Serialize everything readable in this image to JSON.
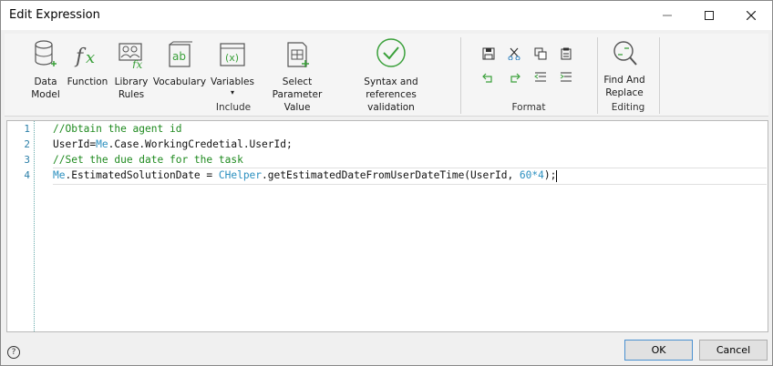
{
  "window": {
    "title": "Edit Expression"
  },
  "ribbon": {
    "include": {
      "label": "Include",
      "buttons": [
        {
          "label_line1": "Data",
          "label_line2": "Model",
          "icon": "database-icon"
        },
        {
          "label_line1": "Function",
          "label_line2": "",
          "icon": "function-icon"
        },
        {
          "label_line1": "Library",
          "label_line2": "Rules",
          "icon": "library-rules-icon"
        },
        {
          "label_line1": "Vocabulary",
          "label_line2": "",
          "icon": "vocabulary-icon"
        },
        {
          "label_line1": "Variables",
          "label_line2": "▾",
          "icon": "variables-icon"
        },
        {
          "label_line1": "Select Parameter",
          "label_line2": "Value",
          "icon": "parameter-icon"
        },
        {
          "label_line1": "Syntax and references",
          "label_line2": "validation",
          "icon": "check-icon"
        }
      ]
    },
    "format": {
      "label": "Format"
    },
    "editing": {
      "label": "Editing",
      "find_line1": "Find And",
      "find_line2": "Replace"
    }
  },
  "editor": {
    "line_numbers": [
      "1",
      "2",
      "3",
      "4"
    ],
    "lines": {
      "l1": "//Obtain the agent id",
      "l2a": "UserId=",
      "l2b": "Me",
      "l2c": ".Case.WorkingCredetial.UserId;",
      "l3": "//Set the due date for the task",
      "l4a": "Me",
      "l4b": ".EstimatedSolutionDate = ",
      "l4c": "CHelper",
      "l4d": ".getEstimatedDateFromUserDateTime(UserId, ",
      "l4e": "60*4",
      "l4f": ");"
    }
  },
  "footer": {
    "ok": "OK",
    "cancel": "Cancel",
    "help": "?"
  },
  "colors": {
    "comment": "#1f8a1f",
    "keyword": "#2a8fbf",
    "icon_green": "#3aa03a"
  }
}
